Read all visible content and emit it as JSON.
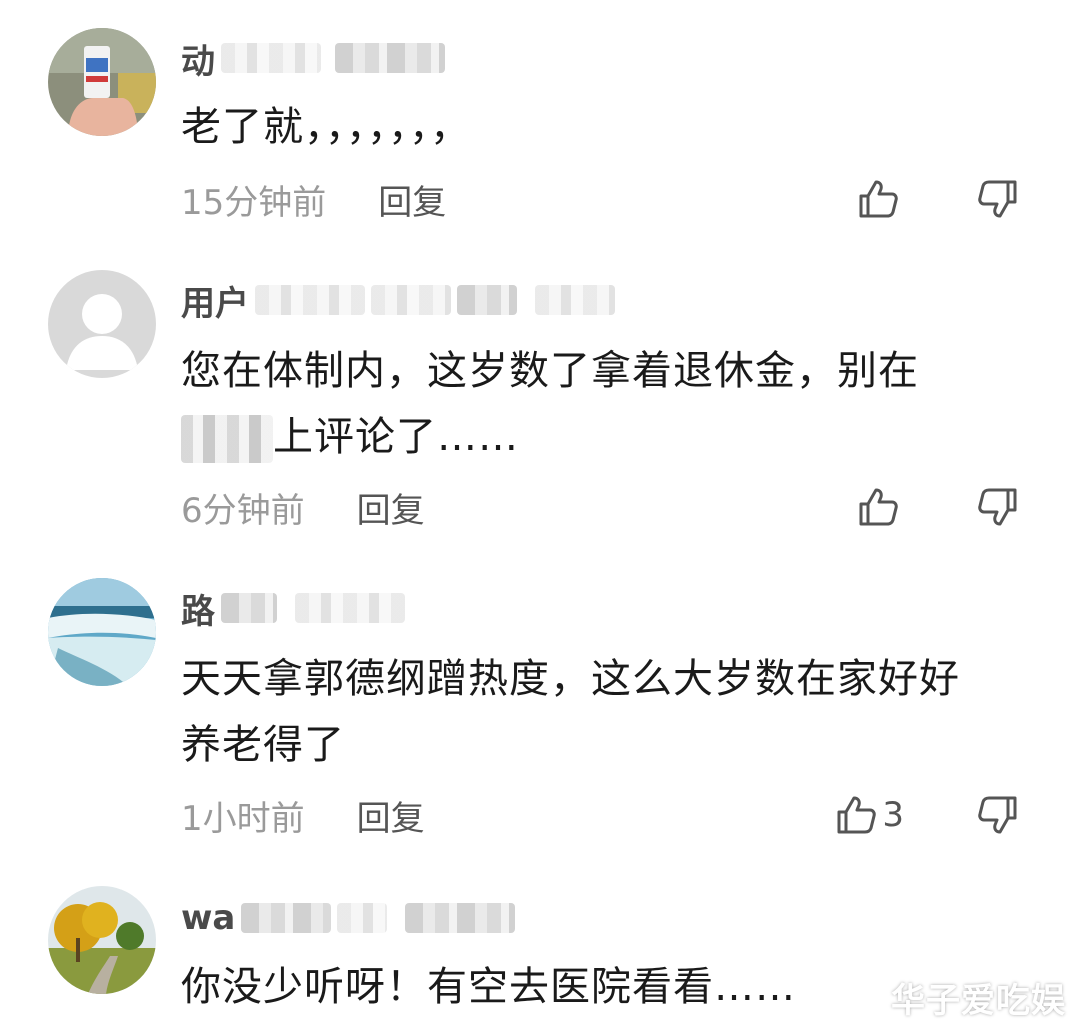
{
  "comments": [
    {
      "avatar": "avatar-photo-hand-holding-cup",
      "name": "动",
      "text": "老了就，，，，，，，",
      "time": "15分钟前",
      "reply": "回复",
      "likes": ""
    },
    {
      "avatar": "avatar-default-user",
      "name": "用户",
      "text_part1": "您在体制内，这岁数了拿着退休金，别在",
      "text_part2": "上评论了……",
      "time": "6分钟前",
      "reply": "回复",
      "likes": ""
    },
    {
      "avatar": "avatar-waterfall-photo",
      "name": "路",
      "text": "天天拿郭德纲蹭热度，这么大岁数在家好好养老得了",
      "time": "1小时前",
      "reply": "回复",
      "likes": "3"
    },
    {
      "avatar": "avatar-autumn-trees-photo",
      "name": "wa",
      "text": "你没少听呀！有空去医院看看……",
      "time": "",
      "reply": "",
      "likes": ""
    }
  ],
  "watermark": "华子爱吃娱",
  "colors": {
    "text": "#1a1a1a",
    "meta": "#9a9a9a",
    "icon": "#555555"
  }
}
